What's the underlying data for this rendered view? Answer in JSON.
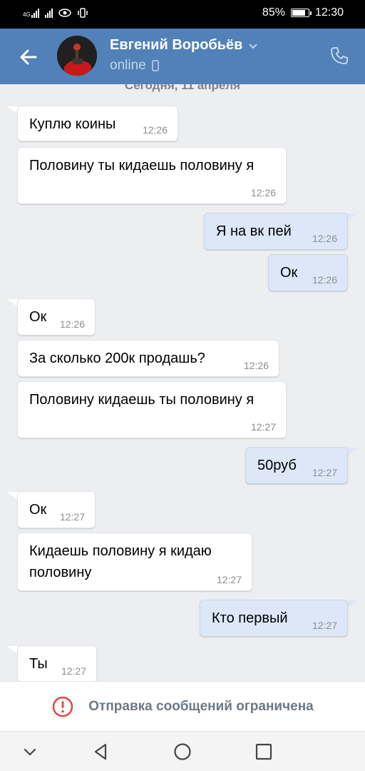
{
  "status_bar": {
    "network": "4G",
    "battery": "85%",
    "battery_level": 0.85,
    "time": "12:30",
    "icons": [
      "signal-icon",
      "signal-icon",
      "eye-icon",
      "vibrate-icon",
      "battery-icon"
    ]
  },
  "header": {
    "back_icon": "arrow-left-icon",
    "contact_name": "Евгений Воробьёв",
    "status": "online",
    "status_icon": "mobile-phone-icon",
    "call_icon": "phone-icon",
    "color": "#5181b8"
  },
  "date_separator": "Сегодня, 11 апреля",
  "messages": [
    {
      "direction": "in",
      "text": "Куплю коины",
      "time": "12:26"
    },
    {
      "direction": "in",
      "text": "Половину ты кидаешь половину я",
      "time": "12:26"
    },
    {
      "direction": "out",
      "text": "Я на вк пей",
      "time": "12:26"
    },
    {
      "direction": "out",
      "text": "Ок",
      "time": "12:26"
    },
    {
      "direction": "in",
      "text": "Ок",
      "time": "12:26"
    },
    {
      "direction": "in",
      "text": "За сколько 200к продашь?",
      "time": "12:26"
    },
    {
      "direction": "in",
      "text": "Половину кидаешь ты половину я",
      "time": "12:27"
    },
    {
      "direction": "out",
      "text": "50руб",
      "time": "12:27"
    },
    {
      "direction": "in",
      "text": "Ок",
      "time": "12:27"
    },
    {
      "direction": "in",
      "text": "Кидаешь половину я кидаю половину",
      "time": "12:27"
    },
    {
      "direction": "out",
      "text": "Кто первый",
      "time": "12:27"
    },
    {
      "direction": "in",
      "text": "Ты",
      "time": "12:27"
    }
  ],
  "restriction": {
    "icon": "warning-circle-icon",
    "text": "Отправка сообщений ограничена",
    "icon_color": "#e64646"
  },
  "navbar": {
    "buttons": [
      "chevron-down-icon",
      "back-triangle-icon",
      "home-circle-icon",
      "recents-square-icon"
    ]
  }
}
